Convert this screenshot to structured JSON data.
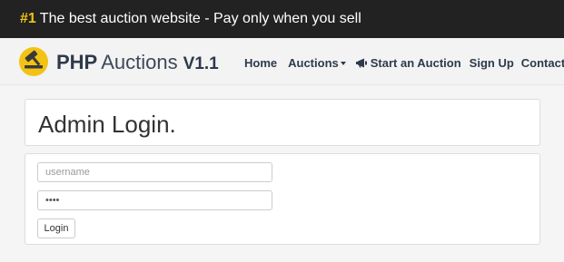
{
  "topbar": {
    "hash": "#1",
    "tagline": "The best auction website - Pay only when you sell"
  },
  "brand": {
    "part1": "PHP",
    "part2": "Auctions",
    "version": "V1.1",
    "logo_icon": "gavel-icon"
  },
  "nav": {
    "home": "Home",
    "auctions": "Auctions",
    "start_auction": "Start an Auction",
    "start_icon": "megaphone-icon",
    "signup": "Sign Up",
    "contact": "Contact"
  },
  "page": {
    "title": "Admin Login."
  },
  "form": {
    "username_placeholder": "username",
    "username_value": "",
    "password_value": "****",
    "login_label": "Login"
  },
  "colors": {
    "topbar_bg": "#222222",
    "accent_yellow": "#f2c314",
    "brand_text": "#2d3a4b",
    "navbar_bg": "#f3f3f3",
    "page_bg": "#f5f5f5"
  }
}
